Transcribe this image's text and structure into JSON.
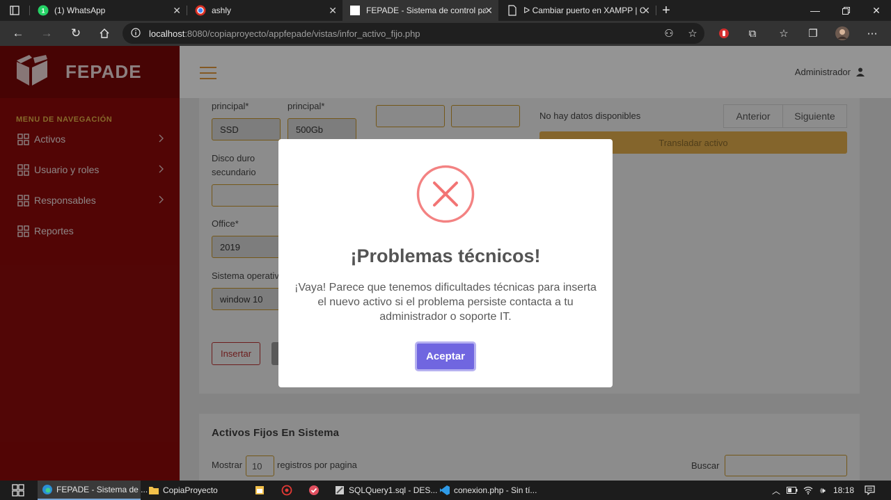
{
  "browser": {
    "tabs": [
      {
        "title": "(1) WhatsApp",
        "icon": "whatsapp-icon"
      },
      {
        "title": "ashly",
        "icon": "chrome-icon"
      },
      {
        "title": "FEPADE - Sistema de control par",
        "icon": "page-icon"
      },
      {
        "title": "ᐅ Cambiar puerto en XAMPP | C",
        "icon": "document-icon"
      }
    ],
    "url_host": "localhost",
    "url_rest": ":8080/copiaproyecto/appfepade/vistas/infor_activo_fijo.php"
  },
  "app": {
    "brand": "FEPADE",
    "nav_heading": "MENU DE NAVEGACIÓN",
    "nav_items": [
      {
        "label": "Activos"
      },
      {
        "label": "Usuario y roles"
      },
      {
        "label": "Responsables"
      },
      {
        "label": "Reportes"
      }
    ],
    "user": "Administrador"
  },
  "form": {
    "label_ram": "principal*",
    "label_disk": "principal*",
    "ram_value": "SSD",
    "disk_value": "500Gb",
    "label_secondary_disk": "Disco duro secundario",
    "label_office": "Office*",
    "office_value": "2019",
    "label_os": "Sistema operativo*",
    "os_value": "window 10",
    "insert_label": "Insertar"
  },
  "transfer": {
    "empty_text": "No hay datos disponibles",
    "prev_label": "Anterior",
    "next_label": "Siguiente",
    "transfer_label": "Transladar activo"
  },
  "list": {
    "title": "Activos Fijos En Sistema",
    "show_label": "Mostrar",
    "show_value": "10",
    "show_suffix": "registros por pagina",
    "search_label": "Buscar"
  },
  "modal": {
    "title": "¡Problemas técnicos!",
    "text": "¡Vaya! Parece que tenemos dificultades técnicas para inserta el nuevo activo si el problema persiste contacta a tu administrador o soporte IT.",
    "button": "Aceptar"
  },
  "taskbar": {
    "items": [
      {
        "label": "FEPADE - Sistema de ..."
      },
      {
        "label": "CopiaProyecto"
      },
      {
        "label": "SQLQuery1.sql - DES..."
      },
      {
        "label": "conexion.php - Sin tí..."
      }
    ],
    "clock": "18:18"
  },
  "colors": {
    "sidebar": "#8e0a0a",
    "accent": "#e3ae4d",
    "modal_button": "#7066e0",
    "error_icon": "#f27474"
  }
}
